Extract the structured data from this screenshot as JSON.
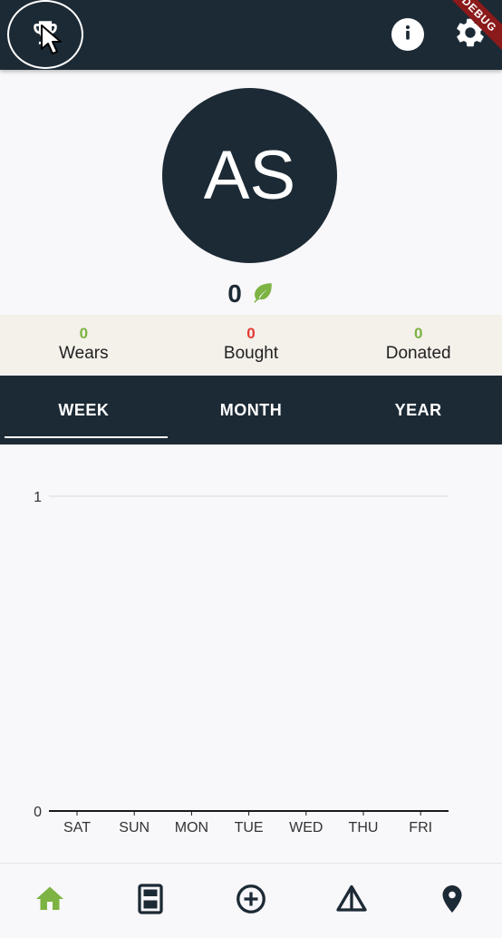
{
  "appbar": {
    "debug_label": "DEBUG",
    "icons": [
      "trophy-icon",
      "info-icon",
      "gear-icon"
    ]
  },
  "profile": {
    "initials": "AS",
    "score": "0",
    "score_icon": "leaf-icon"
  },
  "stats": [
    {
      "value": "0",
      "label": "Wears",
      "color": "#7cb342"
    },
    {
      "value": "0",
      "label": "Bought",
      "color": "#e53935"
    },
    {
      "value": "0",
      "label": "Donated",
      "color": "#7cb342"
    }
  ],
  "tabs": [
    {
      "label": "WEEK",
      "selected": true
    },
    {
      "label": "MONTH",
      "selected": false
    },
    {
      "label": "YEAR",
      "selected": false
    }
  ],
  "chart_data": {
    "type": "bar",
    "categories": [
      "SAT",
      "SUN",
      "MON",
      "TUE",
      "WED",
      "THU",
      "FRI"
    ],
    "values": [
      0,
      0,
      0,
      0,
      0,
      0,
      0
    ],
    "ylim": [
      0,
      1
    ],
    "yticks": [
      "0",
      "1"
    ],
    "grid": true
  },
  "bottom_nav": [
    {
      "icon": "home-icon",
      "active": true
    },
    {
      "icon": "wardrobe-icon",
      "active": false
    },
    {
      "icon": "add-circle-icon",
      "active": false
    },
    {
      "icon": "triangle-icon",
      "active": false
    },
    {
      "icon": "location-pin-icon",
      "active": false
    }
  ],
  "colors": {
    "primary": "#1c2a35",
    "green": "#7cb342",
    "red": "#e53935",
    "stats_bg": "#f4f0ea"
  }
}
